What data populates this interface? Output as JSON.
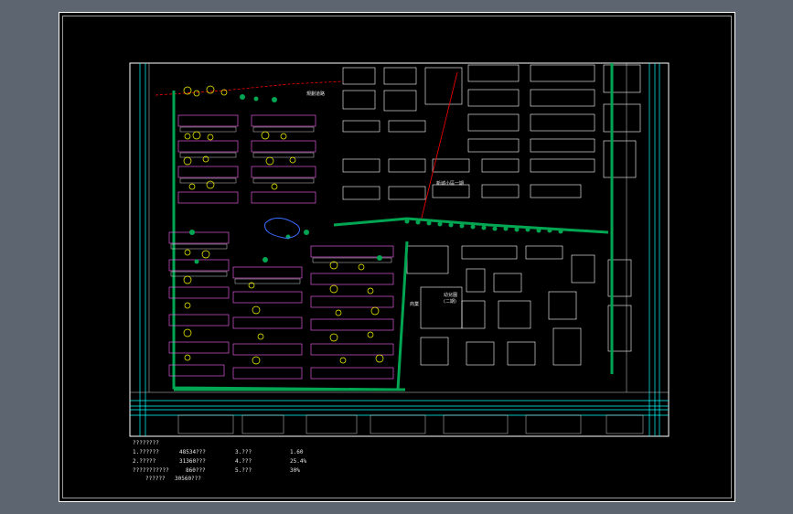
{
  "drawing": {
    "annotations": {
      "north_road": "規劃道路",
      "school_area": "新城小區一期",
      "kindergarten": "幼兒園",
      "kindergarten_sub": "(二期)",
      "commercial": "商業"
    },
    "stats_table": {
      "header": "????????",
      "rows": [
        {
          "c1": "1.??????",
          "c2": "48534???",
          "c3": "3.???",
          "c4": "1.60"
        },
        {
          "c1": "2.?????",
          "c2": "31360???",
          "c3": "4.???",
          "c4": "25.4%"
        },
        {
          "c1": "???????????",
          "c2": "860???",
          "c3": "5.???",
          "c4": "30%"
        },
        {
          "c1": "??????",
          "c2": "30560???",
          "c3": "",
          "c4": ""
        }
      ]
    }
  },
  "colors": {
    "background": "#000000",
    "frame": "#ffffff",
    "green": "#00a651",
    "cyan": "#00ffff",
    "magenta": "#ff00ff",
    "yellow": "#ffff00",
    "red": "#ff0000"
  }
}
